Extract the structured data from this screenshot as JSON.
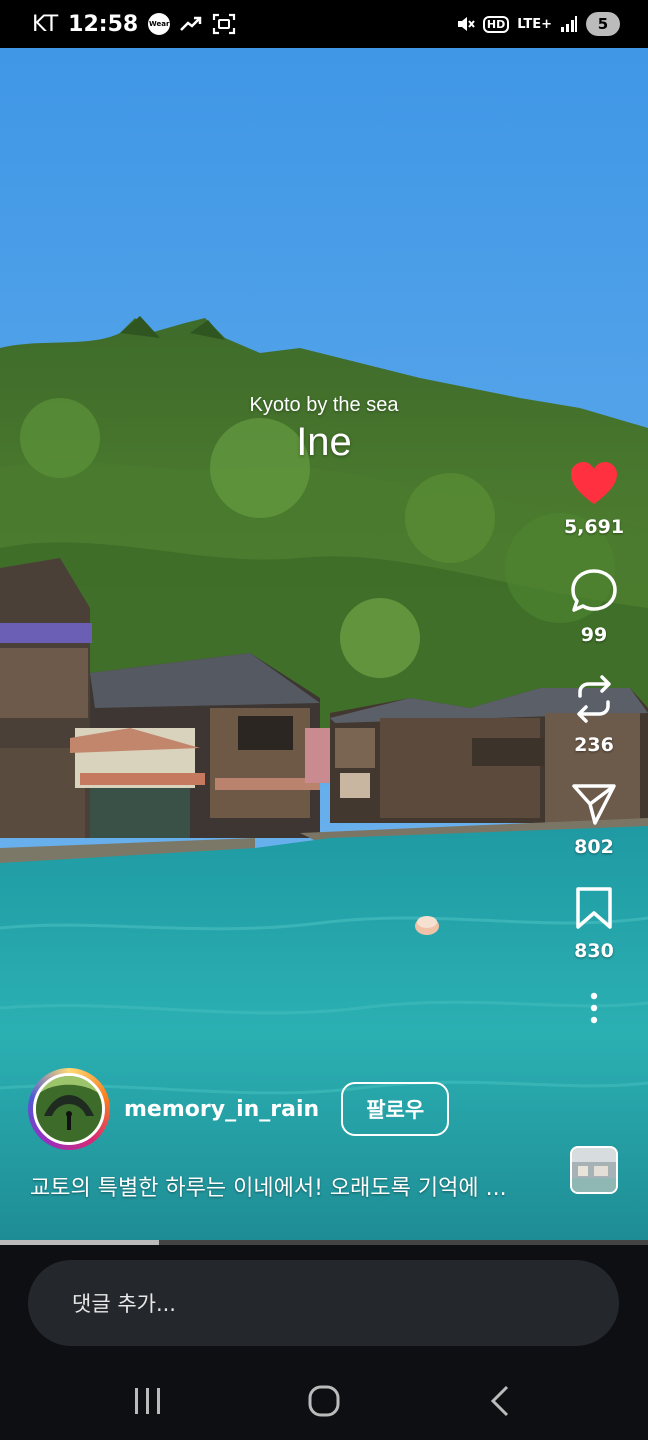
{
  "status_bar": {
    "carrier": "KT",
    "time": "12:58",
    "wear_label": "Wear",
    "hd_label": "HD",
    "network_label": "LTE+",
    "battery_level": "5",
    "icons": [
      "wear-icon",
      "trend-icon",
      "screen-capture-icon",
      "mute-icon",
      "hd-voice-icon",
      "lte-icon",
      "signal-icon",
      "battery-icon"
    ]
  },
  "video": {
    "subtitle": "Kyoto by the sea",
    "title": "Ine",
    "progress": 0.245
  },
  "actions": {
    "like": {
      "count": "5,691",
      "icon": "heart-icon",
      "color": "#ff3040",
      "liked": true
    },
    "comment": {
      "count": "99",
      "icon": "comment-icon"
    },
    "repost": {
      "count": "236",
      "icon": "repost-icon"
    },
    "share": {
      "count": "802",
      "icon": "send-icon"
    },
    "save": {
      "count": "830",
      "icon": "bookmark-icon"
    },
    "more": {
      "icon": "more-vertical-icon"
    }
  },
  "author": {
    "username": "memory_in_rain",
    "follow_label": "팔로우"
  },
  "caption": "교토의 특별한 하루는 이네에서! 오래도록 기억에 ...",
  "comment_input": {
    "placeholder": "댓글 추가..."
  },
  "nav": {
    "icons": [
      "recent-apps-icon",
      "home-icon",
      "back-icon"
    ]
  }
}
